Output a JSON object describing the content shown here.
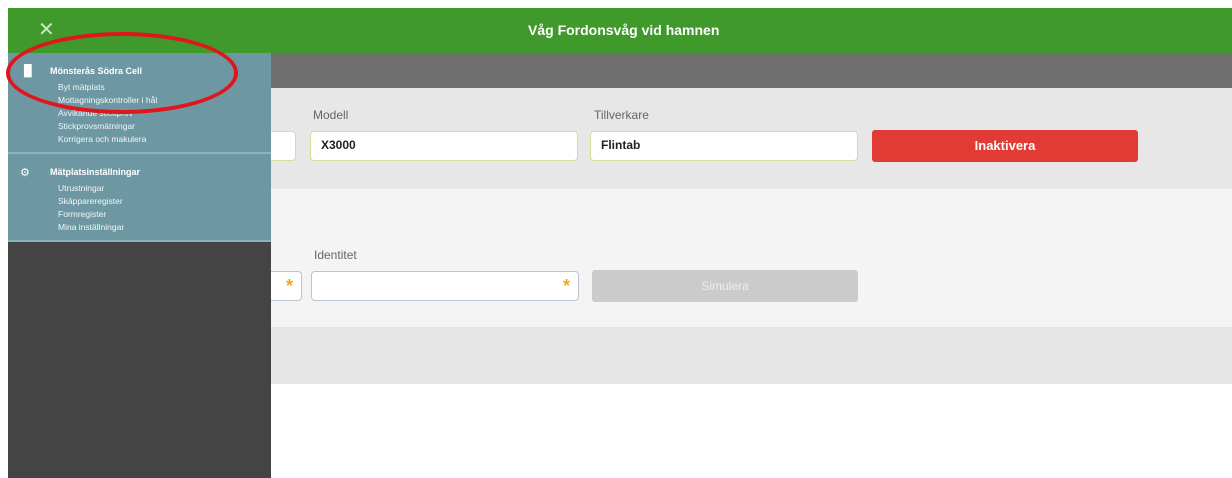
{
  "header": {
    "title": "Våg Fordonsvåg vid hamnen",
    "close_icon": "x-icon"
  },
  "sidebar": {
    "groups": [
      {
        "icon": "bar-chart-icon",
        "title": "Mönsterås Södra Cell",
        "items": [
          {
            "label": "Byt mätplats"
          },
          {
            "label": "Mottagningskontroller i hål"
          },
          {
            "label": "Avvikande stickprov"
          },
          {
            "label": "Stickprovsmätningar"
          },
          {
            "label": "Korrigera och makulera"
          }
        ]
      },
      {
        "icon": "gear-icon",
        "title": "Mätplatsinställningar",
        "items": [
          {
            "label": "Utrustningar"
          },
          {
            "label": "Skäppareregister"
          },
          {
            "label": "Formregister"
          },
          {
            "label": "Mina inställningar"
          }
        ]
      }
    ]
  },
  "equipment": {
    "model_label": "Modell",
    "model_value": "X3000",
    "manufacturer_label": "Tillverkare",
    "manufacturer_value": "Flintab",
    "inactivate_label": "Inaktivera"
  },
  "simulate": {
    "identity_label": "Identitet",
    "identity_value": "",
    "required_mark": "*",
    "simulate_label": "Simulera"
  },
  "colors": {
    "header_green": "#3f9a2b",
    "sidebar_teal": "#6d98a3",
    "danger_red": "#e23b35",
    "required_orange": "#f0a52a",
    "annotation_red": "#e0161b"
  }
}
